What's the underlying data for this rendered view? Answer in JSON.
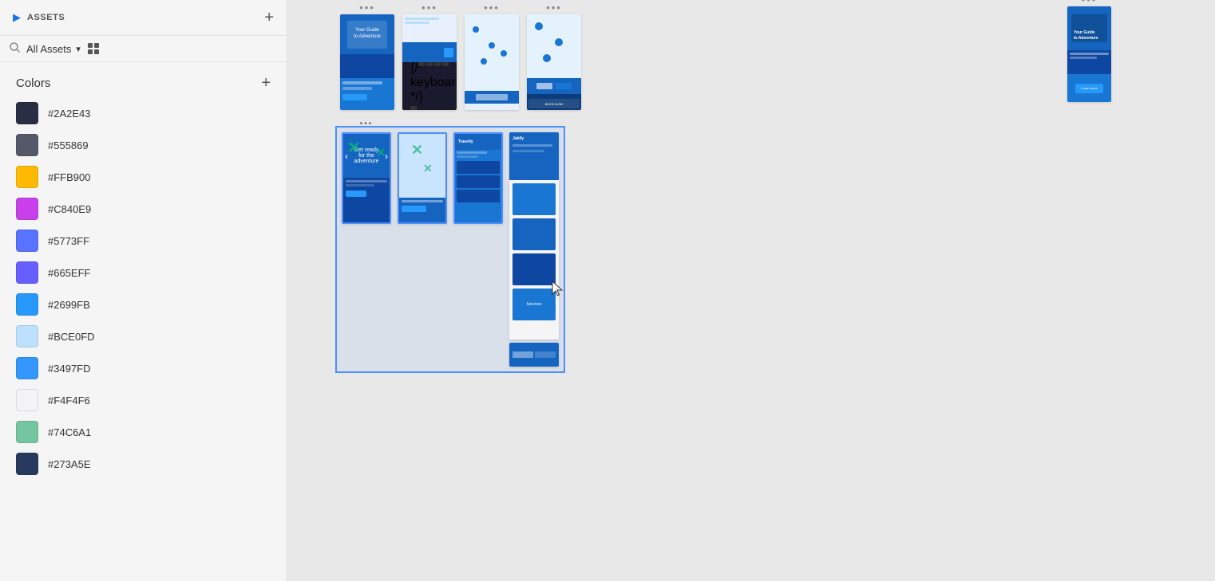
{
  "sidebar": {
    "assets_label": "ASSETS",
    "search_placeholder": "All Assets",
    "collapse_icon": "▶",
    "add_icon": "+",
    "grid_icon": "⊞",
    "chevron_icon": "▾",
    "section": {
      "title": "Colors",
      "add_icon": "+"
    },
    "colors": [
      {
        "hex": "#2A2E43",
        "display": "#2A2E43"
      },
      {
        "hex": "#555869",
        "display": "#555869"
      },
      {
        "hex": "#FFB900",
        "display": "#FFB900"
      },
      {
        "hex": "#C840E9",
        "display": "#C840E9"
      },
      {
        "hex": "#5773FF",
        "display": "#5773FF"
      },
      {
        "hex": "#665EFF",
        "display": "#665EFF"
      },
      {
        "hex": "#2699FB",
        "display": "#2699FB"
      },
      {
        "hex": "#BCE0FD",
        "display": "#BCE0FD"
      },
      {
        "hex": "#3497FD",
        "display": "#3497FD"
      },
      {
        "hex": "#F4F4F6",
        "display": "#F4F4F6"
      },
      {
        "hex": "#74C6A1",
        "display": "#74C6A1"
      },
      {
        "hex": "#273A5E",
        "display": "#273A5E"
      }
    ]
  },
  "canvas": {
    "search_icon": "🔍",
    "cursor_visible": true
  }
}
